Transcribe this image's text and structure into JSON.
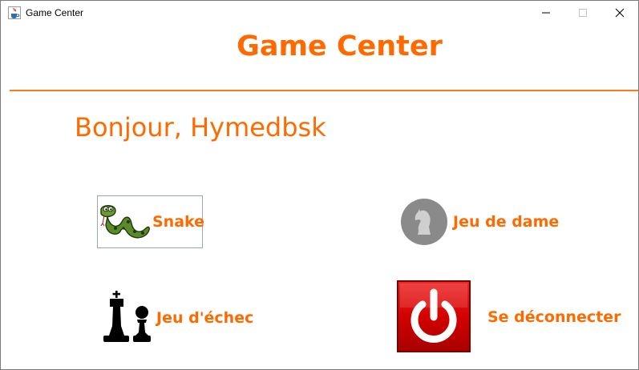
{
  "window": {
    "title": "Game Center"
  },
  "header": {
    "title": "Game Center"
  },
  "greeting": "Bonjour, Hymedbsk",
  "menu": {
    "snake_label": "Snake",
    "dame_label": "Jeu de dame",
    "echec_label": "Jeu d'échec",
    "logout_label": "Se déconnecter"
  },
  "icons": {
    "app": "java-cup-icon",
    "snake": "snake-icon",
    "dame": "knight-piece-icon",
    "echec": "chess-king-pawn-icon",
    "logout": "power-icon"
  },
  "colors": {
    "accent": "#ff6a00",
    "separator": "#ff7a1a",
    "logout_bg": "#d40000",
    "dame_circle": "#8a8a8a"
  }
}
